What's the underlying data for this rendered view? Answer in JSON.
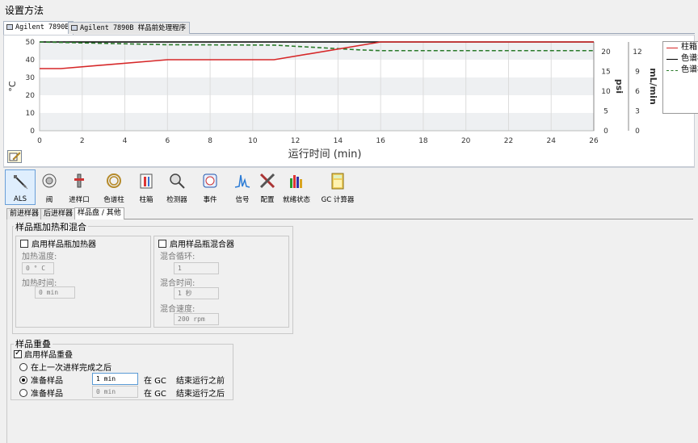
{
  "window": {
    "title": "设置方法"
  },
  "tabs": [
    {
      "label": "Agilent 7890B",
      "active": true
    },
    {
      "label": "Agilent 7890B 样品前处理程序",
      "active": false
    }
  ],
  "chart_data": {
    "type": "line",
    "x_axis": {
      "label": "运行时间 (min)",
      "range": [
        0,
        26
      ],
      "ticks": [
        "0",
        "2",
        "4",
        "6",
        "8",
        "10",
        "12",
        "14",
        "16",
        "18",
        "20",
        "22",
        "24",
        "26"
      ]
    },
    "y_axes": [
      {
        "label": "°C",
        "range": [
          0,
          50
        ],
        "ticks": [
          "0",
          "10",
          "20",
          "30",
          "40",
          "50"
        ]
      },
      {
        "label": "psi",
        "range": [
          0,
          22.5
        ],
        "ticks": [
          "0",
          "5",
          "10",
          "15",
          "20"
        ]
      },
      {
        "label": "mL/min",
        "range": [
          0,
          13.5
        ],
        "ticks": [
          "0",
          "3",
          "6",
          "9",
          "12"
        ]
      }
    ],
    "series": [
      {
        "name": "柱箱:",
        "color": "#d62728",
        "style": "solid",
        "axis": "°C",
        "x": [
          0,
          1,
          6,
          11,
          16,
          26
        ],
        "y": [
          35,
          35,
          40,
          40,
          50,
          50
        ]
      },
      {
        "name": "色谱柱",
        "color": "#000000",
        "style": "solid",
        "axis": "°C",
        "x": [
          0,
          26
        ],
        "y": [
          50,
          50
        ]
      },
      {
        "name": "色谱柱",
        "color": "#2a7a2a",
        "style": "dashed",
        "axis": "psi",
        "x": [
          0,
          6,
          11,
          15,
          16,
          26
        ],
        "y": [
          22.5,
          21.8,
          21.7,
          20.5,
          20.3,
          20.3
        ]
      }
    ]
  },
  "legend": [
    {
      "label": "柱箱:",
      "color": "#d62728",
      "style": "solid"
    },
    {
      "label": "色谱柱",
      "color": "#000000",
      "style": "solid"
    },
    {
      "label": "色谱柱",
      "color": "#2a7a2a",
      "style": "dashed"
    }
  ],
  "toolbar": [
    {
      "label": "ALS",
      "icon": "syringe-icon",
      "active": true
    },
    {
      "label": "阀",
      "icon": "valve-icon"
    },
    {
      "label": "进样口",
      "icon": "inlet-icon"
    },
    {
      "label": "色谱柱",
      "icon": "column-icon"
    },
    {
      "label": "柱箱",
      "icon": "oven-icon"
    },
    {
      "label": "检测器",
      "icon": "detector-icon"
    },
    {
      "label": "事件",
      "icon": "events-icon"
    },
    {
      "label": "信号",
      "icon": "signal-icon"
    },
    {
      "label": "配置",
      "icon": "config-icon"
    },
    {
      "label": "就绪状态",
      "icon": "ready-state-icon"
    },
    {
      "label": "GC 计算器",
      "icon": "calculator-icon"
    }
  ],
  "subtabs": [
    {
      "label": "前进样器",
      "active": false
    },
    {
      "label": "后进样器",
      "active": false
    },
    {
      "label": "样品盘 / 其他",
      "active": true
    }
  ],
  "heating": {
    "group_title": "样品瓶加热和混合",
    "heater_label": "启用样品瓶加热器",
    "heater_checked": false,
    "temp_label": "加热温度:",
    "temp_value": "0 ° C",
    "time_label": "加热时间:",
    "time_value": "0 min",
    "mixer_label": "启用样品瓶混合器",
    "mixer_checked": false,
    "cycles_label": "混合循环:",
    "cycles_value": "1",
    "mix_time_label": "混合时间:",
    "mix_time_value": "1 秒",
    "speed_label": "混合速度:",
    "speed_value": "200 rpm"
  },
  "overlap": {
    "group_title": "样品重叠",
    "enable_label": "启用样品重叠",
    "enable_checked": true,
    "opt1_label": "在上一次进样完成之后",
    "opt2_label": "准备样品",
    "opt2_value": "1 min",
    "opt2_suffix_a": "在 GC",
    "opt2_suffix_b": "结束运行之前",
    "opt3_label": "准备样品",
    "opt3_value": "0 min",
    "opt3_suffix_a": "在 GC",
    "opt3_suffix_b": "结束运行之后",
    "selected": 2
  }
}
